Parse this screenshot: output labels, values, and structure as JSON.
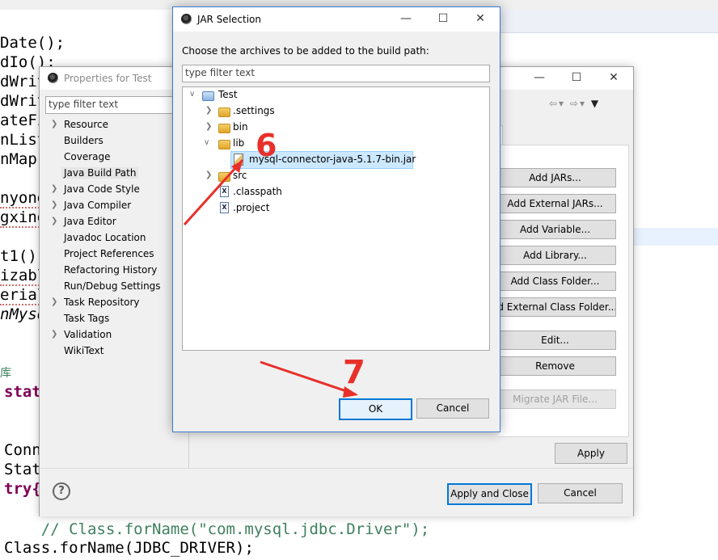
{
  "editor": {
    "lines_left": [
      "Date();",
      "dIo();",
      "dWrit",
      "dWrit",
      "ateFi",
      "nList",
      "nMap(",
      "",
      "nyong",
      "gxing",
      "",
      "t1();",
      "izabl",
      "erial",
      "nMysq"
    ],
    "cjk_char": "库",
    "stat": "stat",
    "conn": "Conn",
    "stat2": "Stat",
    "try": "try{",
    "comment_line": "    // Class.forName(\"com.mysql.jdbc.Driver\");",
    "class_line_prefix": "Class.",
    "class_line_method": "forName",
    "class_line_open": "(",
    "class_line_field": "JDBC_DRIVER",
    "class_line_close": ");"
  },
  "properties_dialog": {
    "title": "Properties for Test",
    "filter_placeholder": "type filter text",
    "tree": [
      {
        "label": "Resource",
        "arrow": true
      },
      {
        "label": "Builders",
        "arrow": false
      },
      {
        "label": "Coverage",
        "arrow": false
      },
      {
        "label": "Java Build Path",
        "arrow": false,
        "selected": true
      },
      {
        "label": "Java Code Style",
        "arrow": true
      },
      {
        "label": "Java Compiler",
        "arrow": true
      },
      {
        "label": "Java Editor",
        "arrow": true
      },
      {
        "label": "Javadoc Location",
        "arrow": false
      },
      {
        "label": "Project References",
        "arrow": false
      },
      {
        "label": "Refactoring History",
        "arrow": false
      },
      {
        "label": "Run/Debug Settings",
        "arrow": false
      },
      {
        "label": "Task Repository",
        "arrow": true
      },
      {
        "label": "Task Tags",
        "arrow": false
      },
      {
        "label": "Validation",
        "arrow": true
      },
      {
        "label": "WikiText",
        "arrow": false
      }
    ],
    "buttons": {
      "add_jars": "Add JARs...",
      "add_external_jars": "Add External JARs...",
      "add_variable": "Add Variable...",
      "add_library": "Add Library...",
      "add_class_folder": "Add Class Folder...",
      "add_external_class_folder": "ld External Class Folder...",
      "edit": "Edit...",
      "remove": "Remove",
      "migrate_jar": "Migrate JAR File..."
    },
    "apply": "Apply",
    "apply_and_close": "Apply and Close",
    "cancel": "Cancel",
    "help": "?"
  },
  "jar_dialog": {
    "title": "JAR Selection",
    "message": "Choose the archives to be added to the build path:",
    "filter_placeholder": "type filter text",
    "tree": {
      "project": "Test",
      "settings": ".settings",
      "bin": "bin",
      "lib": "lib",
      "jar": "mysql-connector-java-5.1.7-bin.jar",
      "src": "src",
      "classpath": ".classpath",
      "project_file": ".project"
    },
    "ok": "OK",
    "cancel": "Cancel"
  },
  "annotations": {
    "step6": "6",
    "step7": "7",
    "color": "#e8302a"
  },
  "icons": {
    "minimize": "minimize-icon",
    "maximize": "maximize-icon",
    "close": "close-icon"
  }
}
